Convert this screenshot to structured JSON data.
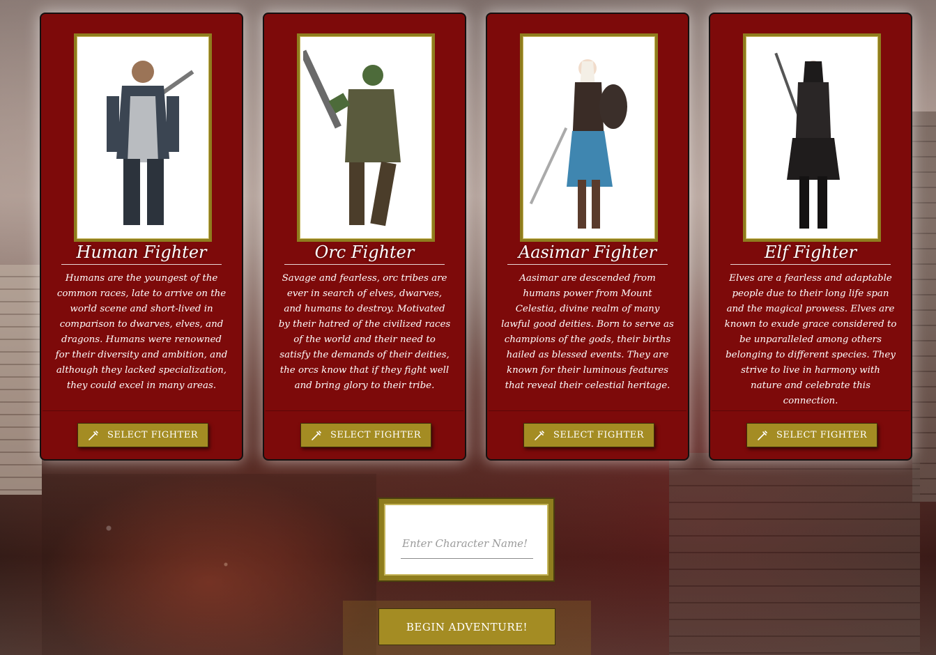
{
  "fighters": [
    {
      "title": "Human Fighter",
      "description": "Humans are the youngest of the common races, late to arrive on the world scene and short-lived in comparison to dwarves, elves, and dragons. Humans were renowned for their diversity and ambition, and although they lacked specialization, they could excel in many areas.",
      "button_label": "SELECT FIGHTER",
      "button_icon": "syringe-icon"
    },
    {
      "title": "Orc Fighter",
      "description": "Savage and fearless, orc tribes are ever in search of elves, dwarves, and humans to destroy. Motivated by their hatred of the civilized races of the world and their need to satisfy the demands of their deities, the orcs know that if they fight well and bring glory to their tribe.",
      "button_label": "SELECT FIGHTER",
      "button_icon": "syringe-icon"
    },
    {
      "title": "Aasimar Fighter",
      "description": "Aasimar are descended from humans power from Mount Celestia, divine realm of many lawful good deities. Born to serve as champions of the gods, their births hailed as blessed events. They are known for their luminous features that reveal their celestial heritage.",
      "button_label": "SELECT FIGHTER",
      "button_icon": "syringe-icon"
    },
    {
      "title": "Elf Fighter",
      "description": "Elves are a fearless and adaptable people due to their long life span and the magical prowess. Elves are known to exude grace considered to be unparalleled among others belonging to different species. They strive to live in harmony with nature and celebrate this connection.",
      "button_label": "SELECT FIGHTER",
      "button_icon": "syringe-icon"
    }
  ],
  "name_input": {
    "placeholder": "Enter Character Name!",
    "value": ""
  },
  "begin_button": {
    "label": "BEGIN ADVENTURE!"
  },
  "colors": {
    "card_bg": "#7d0a0a",
    "gold": "#a48c23",
    "frame_gold": "#8f7d1e"
  }
}
